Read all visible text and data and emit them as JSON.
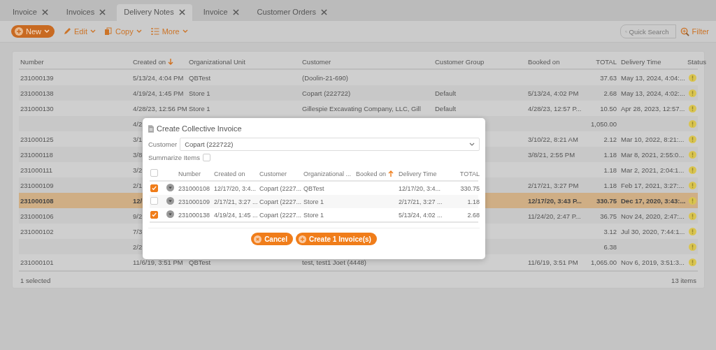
{
  "tabs": [
    {
      "label": "Invoice",
      "selected": false
    },
    {
      "label": "Invoices",
      "selected": false
    },
    {
      "label": "Delivery Notes",
      "selected": true
    },
    {
      "label": "Invoice",
      "selected": false
    },
    {
      "label": "Customer Orders",
      "selected": false
    }
  ],
  "toolbar": {
    "buttons": [
      {
        "label": "New",
        "kind": "new"
      },
      {
        "label": "Edit",
        "kind": "edit"
      },
      {
        "label": "Copy",
        "kind": "copy"
      },
      {
        "label": "More",
        "kind": "more"
      }
    ],
    "search": {
      "placeholder": "Quick Search"
    },
    "filter": "Filter"
  },
  "grid": {
    "columns": [
      {
        "label": "Number",
        "sorted": false
      },
      {
        "label": "Created on",
        "sorted": true,
        "descending": true
      },
      {
        "label": "Organizational Unit",
        "sorted": false
      },
      {
        "label": "Customer",
        "sorted": false
      },
      {
        "label": "Customer Group",
        "sorted": false
      },
      {
        "label": "Booked on",
        "sorted": false
      },
      {
        "label": "TOTAL",
        "sorted": false
      },
      {
        "label": "Delivery Time",
        "sorted": false
      },
      {
        "label": "Status",
        "sorted": false
      }
    ],
    "rows": [
      {
        "number": "231000139",
        "created_on": "5/13/24, 4:04 PM",
        "org_unit": "QBTest",
        "customer": "(Doolin-21-690)",
        "total": "37.63",
        "delivery_time": "May 13, 2024, 4:04:...",
        "warning": true,
        "selected": false
      },
      {
        "number": "231000138",
        "created_on": "4/19/24, 1:45 PM",
        "org_unit": "Store 1",
        "customer": "Copart (222722)",
        "customer_group": "Default",
        "booked_on": "5/13/24, 4:02 PM",
        "total": "2.68",
        "delivery_time": "May 13, 2024, 4:02:...",
        "warning": true,
        "selected": false
      },
      {
        "number": "231000130",
        "created_on": "4/28/23, 12:56 PM",
        "org_unit": "Store 1",
        "customer": "Gillespie Excavating Company, LLC, Gill",
        "customer_group": "Default",
        "booked_on": "4/28/23, 12:57 P...",
        "total": "10.50",
        "delivery_time": "Apr 28, 2023, 12:57...",
        "warning": true,
        "selected": false
      },
      {
        "created_on": "4/2",
        "total": "1,050.00",
        "warning": true,
        "selected": false
      },
      {
        "number": "231000125",
        "created_on": "3/1",
        "booked_on": "3/10/22, 8:21 AM",
        "total": "2.12",
        "delivery_time": "Mar 10, 2022, 8:21:...",
        "warning": true,
        "selected": false
      },
      {
        "number": "231000118",
        "created_on": "3/8",
        "booked_on": "3/8/21, 2:55 PM",
        "total": "1.18",
        "delivery_time": "Mar 8, 2021, 2:55:0...",
        "warning": true,
        "selected": false
      },
      {
        "number": "231000111",
        "created_on": "3/2",
        "total": "1.18",
        "delivery_time": "Mar 2, 2021, 2:04:1...",
        "warning": true,
        "selected": false
      },
      {
        "number": "231000109",
        "created_on": "2/1",
        "booked_on": "2/17/21, 3:27 PM",
        "total": "1.18",
        "delivery_time": "Feb 17, 2021, 3:27:...",
        "warning": true,
        "selected": false
      },
      {
        "number": "231000108",
        "created_on": "12/",
        "booked_on": "12/17/20, 3:43 P...",
        "total": "330.75",
        "delivery_time": "Dec 17, 2020, 3:43:...",
        "warning": true,
        "selected": true
      },
      {
        "number": "231000106",
        "created_on": "9/2",
        "booked_on": "11/24/20, 2:47 P...",
        "total": "36.75",
        "delivery_time": "Nov 24, 2020, 2:47:...",
        "warning": true,
        "selected": false
      },
      {
        "number": "231000102",
        "created_on": "7/3",
        "total": "3.12",
        "delivery_time": "Jul 30, 2020, 7:44:1...",
        "warning": true,
        "selected": false
      },
      {
        "created_on": "2/2",
        "total": "6.38",
        "warning": true,
        "selected": false
      },
      {
        "number": "231000101",
        "created_on": "11/6/19, 3:51 PM",
        "org_unit": "QBTest",
        "customer": "test, test1 Joet (4448)",
        "booked_on": "11/6/19, 3:51 PM",
        "total": "1,065.00",
        "delivery_time": "Nov 6, 2019, 3:51:3...",
        "warning": true,
        "selected": false
      }
    ],
    "footer": {
      "selected": "1 selected",
      "count": "13 items"
    }
  },
  "dialog": {
    "title": "Create Collective Invoice",
    "customer_label": "Customer",
    "customer_value": "Copart (222722)",
    "summarize": {
      "label": "Summarize Items",
      "checked": false
    },
    "select_all_checked": false,
    "columns": [
      {
        "label": "Number",
        "sorted": false
      },
      {
        "label": "Created on",
        "sorted": false
      },
      {
        "label": "Customer",
        "sorted": false
      },
      {
        "label": "Organizational ...",
        "sorted": false
      },
      {
        "label": "Booked on",
        "sorted": true,
        "descending": false
      },
      {
        "label": "Delivery Time",
        "sorted": false
      },
      {
        "label": "TOTAL",
        "sorted": false
      }
    ],
    "rows": [
      {
        "checked": true,
        "number": "231000108",
        "created_on": "12/17/20, 3:4...",
        "customer": "Copart (2227...",
        "org_unit": "QBTest",
        "delivery_time": "12/17/20, 3:4...",
        "total": "330.75"
      },
      {
        "checked": false,
        "number": "231000109",
        "created_on": "2/17/21, 3:27 ...",
        "customer": "Copart (2227...",
        "org_unit": "Store 1",
        "delivery_time": "2/17/21, 3:27 ...",
        "total": "1.18"
      },
      {
        "checked": true,
        "number": "231000138",
        "created_on": "4/19/24, 1:45 ...",
        "customer": "Copart (2227...",
        "org_unit": "Store 1",
        "delivery_time": "5/13/24, 4:02 ...",
        "total": "2.68"
      }
    ],
    "buttons": [
      {
        "label": "Cancel",
        "kind": "cancel"
      },
      {
        "label": "Create 1 Invoice(s)",
        "kind": "create"
      }
    ]
  }
}
